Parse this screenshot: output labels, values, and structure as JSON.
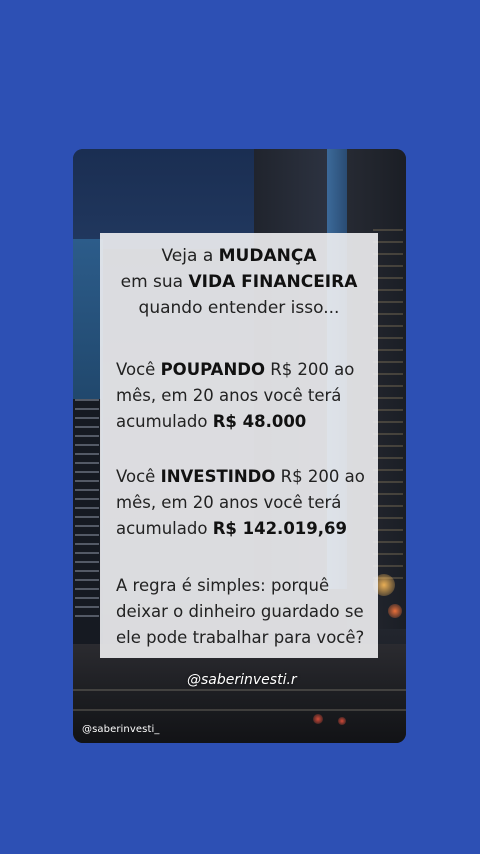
{
  "colors": {
    "background": "#2d50b4",
    "panel": "#f0f0f2",
    "text": "#222222",
    "watermark": "#ffffff"
  },
  "intro": {
    "line1_pre": "Veja a ",
    "line1_bold": "MUDANÇA",
    "line2_pre": "em sua ",
    "line2_bold": "VIDA FINANCEIRA",
    "line3": "quando entender isso..."
  },
  "poupando": {
    "pre": "Você ",
    "bold": "POUPANDO",
    "post": " R$ 200 ao",
    "line2": "mês, em 20 anos você terá",
    "line3_pre": "acumulado ",
    "amount": "R$ 48.000"
  },
  "investindo": {
    "pre": "Você ",
    "bold": "INVESTINDO",
    "post": " R$ 200 ao",
    "line2": "mês, em 20 anos você terá",
    "line3_pre": "acumulado ",
    "amount": "R$ 142.019,69"
  },
  "conclusion": {
    "line1": "A regra é simples: porquê",
    "line2": "deixar o dinheiro guardado se",
    "line3": "ele pode trabalhar para você?"
  },
  "watermark": "@saberinvesti.r",
  "handle": "@saberinvesti_"
}
